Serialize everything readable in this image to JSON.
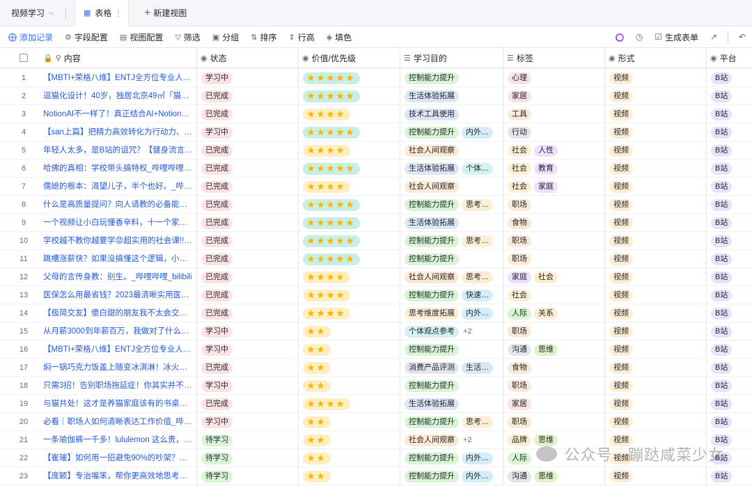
{
  "viewbar": {
    "table_name": "视频学习",
    "tab_label": "表格",
    "new_view": "新建视图"
  },
  "toolbar": {
    "add_record": "添加记录",
    "field_config": "字段配置",
    "view_config": "视图配置",
    "filter": "筛选",
    "group": "分组",
    "sort": "排序",
    "row_height": "行高",
    "fill_color": "填色",
    "generate_form": "生成表单"
  },
  "columns": {
    "content": "内容",
    "status": "状态",
    "priority": "价值/优先级",
    "purpose": "学习目的",
    "tags": "标签",
    "form": "形式",
    "platform": "平台"
  },
  "colors": {
    "status": {
      "学习中": "#fde2e4",
      "已完成": "#fde2e4",
      "待学习": "#d9f5d6"
    },
    "purpose": {
      "控制能力提升": "#d9f5d6",
      "生活体验拓展": "#dce6f7",
      "技术工具使用": "#dce6f7",
      "社会人间观察": "#fde9d5",
      "个体观点参考": "#d4f2ef",
      "消费产品评测": "#e4e6e9",
      "思考维度拓展": "#fdeed4",
      "内外…": "#d4eef9",
      "个体…": "#d4f2ef",
      "思考…": "#fdeed4",
      "快速…": "#d4eef9",
      "生活…": "#dce6f7",
      "+2": "transparent"
    },
    "tags": {
      "心理": "#fde2e4",
      "家居": "#fde2e4",
      "工具": "#fde9d5",
      "行动": "#e4e6e9",
      "社会": "#fdeed4",
      "人性": "#ece2fe",
      "教育": "#ece2fe",
      "家庭": "#ece2fe",
      "职场": "#fde9d5",
      "食物": "#fde9d5",
      "人际": "#d9f5d6",
      "关系": "#fdeed4",
      "沟通": "#e4e6e9",
      "思维": "#e0f3c9",
      "品牌": "#fdeed4"
    },
    "form": "#fdeed4",
    "platform": "#e2e5fb",
    "stars_bg": {
      "5": "#c7efe5",
      "4": "#fdeec4",
      "2": "#fdeec4"
    }
  },
  "rows": [
    {
      "n": "1",
      "title": "【MBTI+荣格八维】ENTJ全方位专业人…",
      "status": "学习中",
      "stars": 5,
      "purpose": [
        "控制能力提升"
      ],
      "tags": [
        "心理"
      ],
      "form": "视频",
      "platform": "B站"
    },
    {
      "n": "2",
      "title": "逗猫化设计！40岁，独居北京49㎡「猫…",
      "status": "已完成",
      "stars": 5,
      "purpose": [
        "生活体验拓展"
      ],
      "tags": [
        "家居"
      ],
      "form": "视频",
      "platform": "B站"
    },
    {
      "n": "3",
      "title": "NotionAI不一样了！真正结合AI+Notion…",
      "status": "已完成",
      "stars": 4,
      "purpose": [
        "技术工具使用"
      ],
      "tags": [
        "工具"
      ],
      "form": "视频",
      "platform": "B站"
    },
    {
      "n": "4",
      "title": "【san上篇】把精力高效转化为行动力、…",
      "status": "学习中",
      "stars": 5,
      "purpose": [
        "控制能力提升",
        "内外…"
      ],
      "tags": [
        "行动"
      ],
      "form": "视频",
      "platform": "B站"
    },
    {
      "n": "5",
      "title": "年轻人太多，是B站的诅咒？【健身流言…",
      "status": "已完成",
      "stars": 4,
      "purpose": [
        "社会人间观察"
      ],
      "tags": [
        "社会",
        "人性"
      ],
      "form": "视频",
      "platform": "B站"
    },
    {
      "n": "6",
      "title": "哈佛的真相：学校带头搞特权_哔哩哔哩…",
      "status": "已完成",
      "stars": 5,
      "purpose": [
        "生活体验拓展",
        "个体…"
      ],
      "tags": [
        "社会",
        "教育"
      ],
      "form": "视频",
      "platform": "B站"
    },
    {
      "n": "7",
      "title": "儒媳的根本：渴望儿子，半个也好。_哔…",
      "status": "已完成",
      "stars": 4,
      "purpose": [
        "社会人间观察"
      ],
      "tags": [
        "社会",
        "家庭"
      ],
      "form": "视频",
      "platform": "B站"
    },
    {
      "n": "8",
      "title": "什么是高质量提问？向人请教的必备能…",
      "status": "已完成",
      "stars": 5,
      "purpose": [
        "控制能力提升",
        "思考…"
      ],
      "tags": [
        "职场"
      ],
      "form": "视频",
      "platform": "B站"
    },
    {
      "n": "9",
      "title": "一个视频让小白玩懂香辛料，十一个家…",
      "status": "已完成",
      "stars": 5,
      "purpose": [
        "生活体验拓展"
      ],
      "tags": [
        "食物"
      ],
      "form": "视频",
      "platform": "B站"
    },
    {
      "n": "10",
      "title": "学校越不教你越要学😡超实用的社会课!!…",
      "status": "已完成",
      "stars": 5,
      "purpose": [
        "控制能力提升",
        "思考…"
      ],
      "tags": [
        "职场"
      ],
      "form": "视频",
      "platform": "B站"
    },
    {
      "n": "11",
      "title": "跳槽涨薪快？如果没搞懂这个逻辑，小…",
      "status": "已完成",
      "stars": 5,
      "purpose": [
        "控制能力提升"
      ],
      "tags": [
        "职场"
      ],
      "form": "视频",
      "platform": "B站"
    },
    {
      "n": "12",
      "title": "父母的言传身教：别生。_哔哩哔哩_bilibili",
      "status": "已完成",
      "stars": 4,
      "purpose": [
        "社会人间观察",
        "思考…"
      ],
      "tags": [
        "家庭",
        "社会"
      ],
      "form": "视频",
      "platform": "B站"
    },
    {
      "n": "13",
      "title": "医保怎么用最省钱？2023最清晰实用医…",
      "status": "已完成",
      "stars": 4,
      "purpose": [
        "控制能力提升",
        "快速…"
      ],
      "tags": [
        "社会"
      ],
      "form": "视频",
      "platform": "B站"
    },
    {
      "n": "14",
      "title": "【极简交友】傻白甜的朋友我不太会交…",
      "status": "已完成",
      "stars": 4,
      "purpose": [
        "思考维度拓展",
        "内外…"
      ],
      "tags": [
        "人际",
        "关系"
      ],
      "form": "视频",
      "platform": "B站"
    },
    {
      "n": "15",
      "title": "从月薪3000到年薪百万，我做对了什么…",
      "status": "学习中",
      "stars": 2,
      "purpose": [
        "个体观点参考",
        "+2"
      ],
      "tags": [
        "职场"
      ],
      "form": "视频",
      "platform": "B站"
    },
    {
      "n": "16",
      "title": "【MBTI+荣格八维】ENTJ全方位专业人…",
      "status": "学习中",
      "stars": 2,
      "purpose": [
        "控制能力提升"
      ],
      "tags": [
        "沟通",
        "思维"
      ],
      "form": "视频",
      "platform": "B站"
    },
    {
      "n": "17",
      "title": "焖一锅巧克力饭盖上随变冰淇淋！冰火…",
      "status": "已完成",
      "stars": 2,
      "purpose": [
        "消费产品评测",
        "生活…"
      ],
      "tags": [
        "食物"
      ],
      "form": "视频",
      "platform": "B站"
    },
    {
      "n": "18",
      "title": "只需3招！告别职场拖延症！你其实并不…",
      "status": "学习中",
      "stars": 2,
      "purpose": [
        "控制能力提升"
      ],
      "tags": [
        "职场"
      ],
      "form": "视频",
      "platform": "B站"
    },
    {
      "n": "19",
      "title": "与猫共处！这才是养猫家庭该有的书桌…",
      "status": "已完成",
      "stars": 4,
      "purpose": [
        "生活体验拓展"
      ],
      "tags": [
        "家居"
      ],
      "form": "视频",
      "platform": "B站"
    },
    {
      "n": "20",
      "title": "必看｜职场人如何清晰表达工作价值_哔…",
      "status": "学习中",
      "stars": 2,
      "purpose": [
        "控制能力提升",
        "思考…"
      ],
      "tags": [
        "职场"
      ],
      "form": "视频",
      "platform": "B站"
    },
    {
      "n": "21",
      "title": "一条瑜伽裤一千多！lululemon 这么贵，…",
      "status": "待学习",
      "stars": 2,
      "purpose": [
        "社会人间观察",
        "+2"
      ],
      "tags": [
        "品牌",
        "思维"
      ],
      "form": "视频",
      "platform": "B站"
    },
    {
      "n": "22",
      "title": "【崔璀】如何用一招避免90%的吵架？…",
      "status": "待学习",
      "stars": 2,
      "purpose": [
        "控制能力提升",
        "内外…"
      ],
      "tags": [
        "人际"
      ],
      "form": "视频",
      "platform": "B站"
    },
    {
      "n": "23",
      "title": "【庞颖】专治嘴笨，帮你更高效地思考…",
      "status": "待学习",
      "stars": 2,
      "purpose": [
        "控制能力提升",
        "内外…"
      ],
      "tags": [
        "沟通",
        "思维"
      ],
      "form": "视频",
      "platform": "B站"
    }
  ],
  "watermark": "公众号 · 蹦跶咸菜少女"
}
